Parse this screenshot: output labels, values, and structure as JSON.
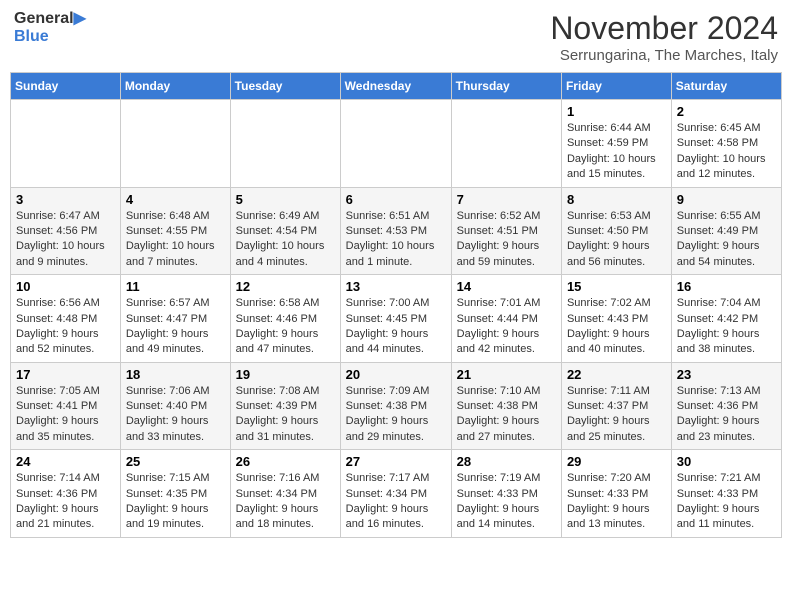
{
  "logo": {
    "line1": "General",
    "line2": "Blue"
  },
  "title": "November 2024",
  "subtitle": "Serrungarina, The Marches, Italy",
  "days_of_week": [
    "Sunday",
    "Monday",
    "Tuesday",
    "Wednesday",
    "Thursday",
    "Friday",
    "Saturday"
  ],
  "weeks": [
    [
      {
        "day": "",
        "info": ""
      },
      {
        "day": "",
        "info": ""
      },
      {
        "day": "",
        "info": ""
      },
      {
        "day": "",
        "info": ""
      },
      {
        "day": "",
        "info": ""
      },
      {
        "day": "1",
        "info": "Sunrise: 6:44 AM\nSunset: 4:59 PM\nDaylight: 10 hours and 15 minutes."
      },
      {
        "day": "2",
        "info": "Sunrise: 6:45 AM\nSunset: 4:58 PM\nDaylight: 10 hours and 12 minutes."
      }
    ],
    [
      {
        "day": "3",
        "info": "Sunrise: 6:47 AM\nSunset: 4:56 PM\nDaylight: 10 hours and 9 minutes."
      },
      {
        "day": "4",
        "info": "Sunrise: 6:48 AM\nSunset: 4:55 PM\nDaylight: 10 hours and 7 minutes."
      },
      {
        "day": "5",
        "info": "Sunrise: 6:49 AM\nSunset: 4:54 PM\nDaylight: 10 hours and 4 minutes."
      },
      {
        "day": "6",
        "info": "Sunrise: 6:51 AM\nSunset: 4:53 PM\nDaylight: 10 hours and 1 minute."
      },
      {
        "day": "7",
        "info": "Sunrise: 6:52 AM\nSunset: 4:51 PM\nDaylight: 9 hours and 59 minutes."
      },
      {
        "day": "8",
        "info": "Sunrise: 6:53 AM\nSunset: 4:50 PM\nDaylight: 9 hours and 56 minutes."
      },
      {
        "day": "9",
        "info": "Sunrise: 6:55 AM\nSunset: 4:49 PM\nDaylight: 9 hours and 54 minutes."
      }
    ],
    [
      {
        "day": "10",
        "info": "Sunrise: 6:56 AM\nSunset: 4:48 PM\nDaylight: 9 hours and 52 minutes."
      },
      {
        "day": "11",
        "info": "Sunrise: 6:57 AM\nSunset: 4:47 PM\nDaylight: 9 hours and 49 minutes."
      },
      {
        "day": "12",
        "info": "Sunrise: 6:58 AM\nSunset: 4:46 PM\nDaylight: 9 hours and 47 minutes."
      },
      {
        "day": "13",
        "info": "Sunrise: 7:00 AM\nSunset: 4:45 PM\nDaylight: 9 hours and 44 minutes."
      },
      {
        "day": "14",
        "info": "Sunrise: 7:01 AM\nSunset: 4:44 PM\nDaylight: 9 hours and 42 minutes."
      },
      {
        "day": "15",
        "info": "Sunrise: 7:02 AM\nSunset: 4:43 PM\nDaylight: 9 hours and 40 minutes."
      },
      {
        "day": "16",
        "info": "Sunrise: 7:04 AM\nSunset: 4:42 PM\nDaylight: 9 hours and 38 minutes."
      }
    ],
    [
      {
        "day": "17",
        "info": "Sunrise: 7:05 AM\nSunset: 4:41 PM\nDaylight: 9 hours and 35 minutes."
      },
      {
        "day": "18",
        "info": "Sunrise: 7:06 AM\nSunset: 4:40 PM\nDaylight: 9 hours and 33 minutes."
      },
      {
        "day": "19",
        "info": "Sunrise: 7:08 AM\nSunset: 4:39 PM\nDaylight: 9 hours and 31 minutes."
      },
      {
        "day": "20",
        "info": "Sunrise: 7:09 AM\nSunset: 4:38 PM\nDaylight: 9 hours and 29 minutes."
      },
      {
        "day": "21",
        "info": "Sunrise: 7:10 AM\nSunset: 4:38 PM\nDaylight: 9 hours and 27 minutes."
      },
      {
        "day": "22",
        "info": "Sunrise: 7:11 AM\nSunset: 4:37 PM\nDaylight: 9 hours and 25 minutes."
      },
      {
        "day": "23",
        "info": "Sunrise: 7:13 AM\nSunset: 4:36 PM\nDaylight: 9 hours and 23 minutes."
      }
    ],
    [
      {
        "day": "24",
        "info": "Sunrise: 7:14 AM\nSunset: 4:36 PM\nDaylight: 9 hours and 21 minutes."
      },
      {
        "day": "25",
        "info": "Sunrise: 7:15 AM\nSunset: 4:35 PM\nDaylight: 9 hours and 19 minutes."
      },
      {
        "day": "26",
        "info": "Sunrise: 7:16 AM\nSunset: 4:34 PM\nDaylight: 9 hours and 18 minutes."
      },
      {
        "day": "27",
        "info": "Sunrise: 7:17 AM\nSunset: 4:34 PM\nDaylight: 9 hours and 16 minutes."
      },
      {
        "day": "28",
        "info": "Sunrise: 7:19 AM\nSunset: 4:33 PM\nDaylight: 9 hours and 14 minutes."
      },
      {
        "day": "29",
        "info": "Sunrise: 7:20 AM\nSunset: 4:33 PM\nDaylight: 9 hours and 13 minutes."
      },
      {
        "day": "30",
        "info": "Sunrise: 7:21 AM\nSunset: 4:33 PM\nDaylight: 9 hours and 11 minutes."
      }
    ]
  ]
}
